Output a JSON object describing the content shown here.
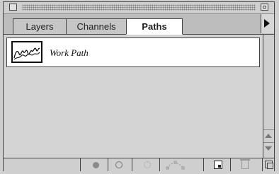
{
  "palette": {
    "tabs": [
      {
        "label": "Layers"
      },
      {
        "label": "Channels"
      },
      {
        "label": "Paths"
      }
    ],
    "active_tab": "Paths"
  },
  "paths_list": [
    {
      "name": "Work Path",
      "thumbnail_icon": "squiggle-path-thumbnail"
    }
  ],
  "toolbar": {
    "icons": [
      "fill-path-icon",
      "stroke-path-icon",
      "load-selection-icon",
      "make-work-path-icon",
      "new-path-icon",
      "trash-icon"
    ]
  }
}
